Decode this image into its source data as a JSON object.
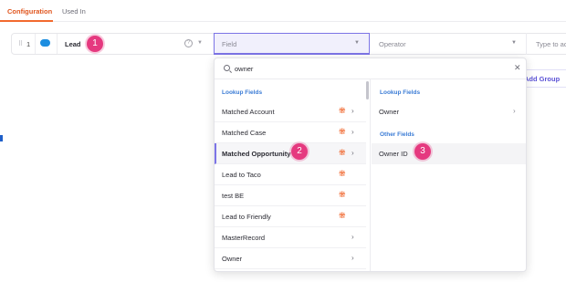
{
  "tabs": [
    {
      "label": "Configuration",
      "active": true
    },
    {
      "label": "Used In",
      "active": false
    }
  ],
  "row": {
    "index": "1",
    "object_label": "Lead",
    "object_icon": "salesforce-cloud-icon",
    "field_placeholder": "Field",
    "operator_placeholder": "Operator",
    "value_placeholder": "Type to ad"
  },
  "add_group_label": "Add Group",
  "dropdown": {
    "search_value": "owner",
    "left_section_title": "Lookup Fields",
    "left_items": [
      {
        "label": "Matched Account",
        "badge": true,
        "chevron": true
      },
      {
        "label": "Matched Case",
        "badge": true,
        "chevron": true
      },
      {
        "label": "Matched Opportunity",
        "badge": true,
        "chevron": true,
        "selected": true
      },
      {
        "label": "Lead to Taco",
        "badge": true,
        "chevron": false
      },
      {
        "label": "test BE",
        "badge": true,
        "chevron": false
      },
      {
        "label": "Lead to Friendly",
        "badge": true,
        "chevron": false
      },
      {
        "label": "MasterRecord",
        "badge": false,
        "chevron": true
      },
      {
        "label": "Owner",
        "badge": false,
        "chevron": true
      }
    ],
    "right_lookup_title": "Lookup Fields",
    "right_lookup_items": [
      {
        "label": "Owner",
        "chevron": true
      }
    ],
    "right_other_title": "Other Fields",
    "right_other_items": [
      {
        "label": "Owner ID",
        "chevron": false
      }
    ]
  },
  "callouts": [
    "1",
    "2",
    "3"
  ],
  "colors": {
    "accent": "#7c74e6",
    "tab_active": "#e0561f",
    "callout": "#e5397f",
    "section_title": "#3a7bd5",
    "badge": "#f0652b"
  }
}
